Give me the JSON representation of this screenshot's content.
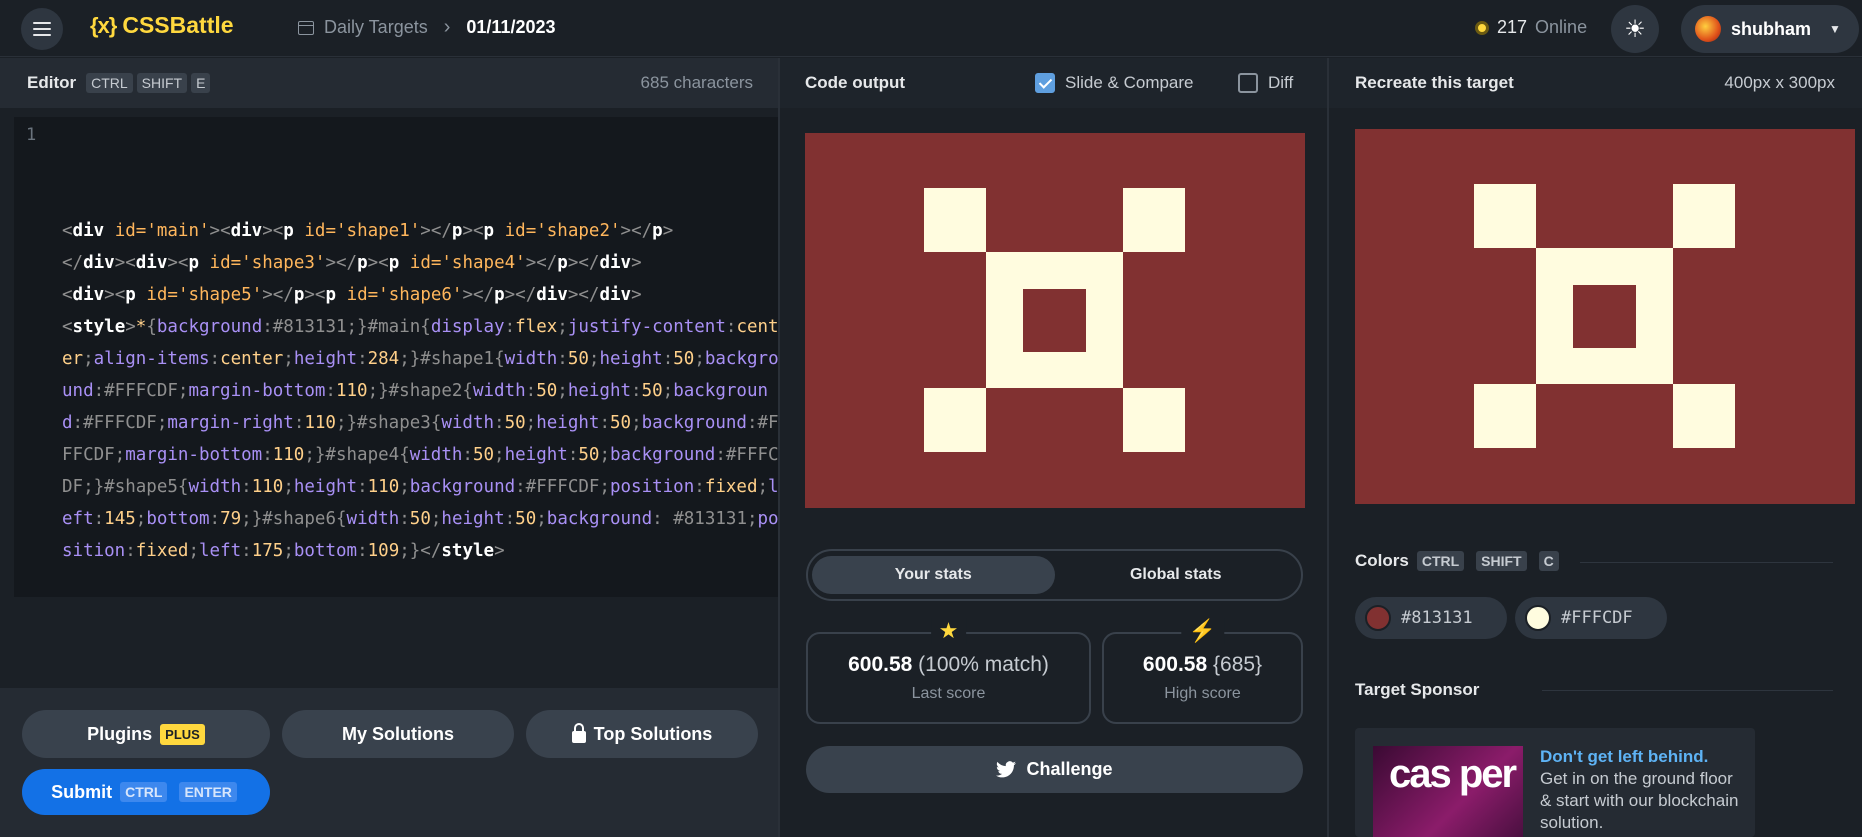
{
  "header": {
    "logo_text": "CSSBattle",
    "logo_mark": "{x}",
    "breadcrumb_parent": "Daily Targets",
    "breadcrumb_current": "01/11/2023",
    "online_count": "217",
    "online_label": "Online",
    "username": "shubham"
  },
  "editor": {
    "title": "Editor",
    "shortcut": [
      "CTRL",
      "SHIFT",
      "E"
    ],
    "chars": "685 characters",
    "line_number": "1"
  },
  "editor_footer": {
    "plugins_label": "Plugins",
    "plus_badge": "PLUS",
    "my_solutions_label": "My Solutions",
    "top_solutions_label": "Top Solutions",
    "submit_label": "Submit",
    "submit_shortcut": [
      "CTRL",
      "ENTER"
    ]
  },
  "output": {
    "title": "Code output",
    "slide_compare_label": "Slide & Compare",
    "slide_compare_checked": true,
    "diff_label": "Diff",
    "diff_checked": false
  },
  "stats": {
    "tab_your": "Your stats",
    "tab_global": "Global stats",
    "last_score": "600.58",
    "last_match": "(100% match)",
    "last_label": "Last score",
    "high_score": "600.58",
    "high_chars": "{685}",
    "high_label": "High score",
    "challenge_label": "Challenge"
  },
  "target": {
    "title": "Recreate this target",
    "size": "400px x 300px",
    "colors_title": "Colors",
    "colors_shortcut": [
      "CTRL",
      "SHIFT",
      "C"
    ],
    "colors": [
      {
        "hex": "#813131"
      },
      {
        "hex": "#FFFCDF",
        "label": "#FFFCDF"
      }
    ],
    "color_labels": [
      "#813131",
      "#FFFCDF"
    ],
    "sponsor_title": "Target Sponsor",
    "sponsor_logo": "cas per",
    "sponsor_headline": "Don't get left behind.",
    "sponsor_body": "Get in on the ground floor & start with our blockchain solution."
  },
  "colors": {
    "bg": "#813131",
    "fg": "#FFFCDF",
    "accent": "#FFD83E",
    "submit": "#1371E6"
  }
}
